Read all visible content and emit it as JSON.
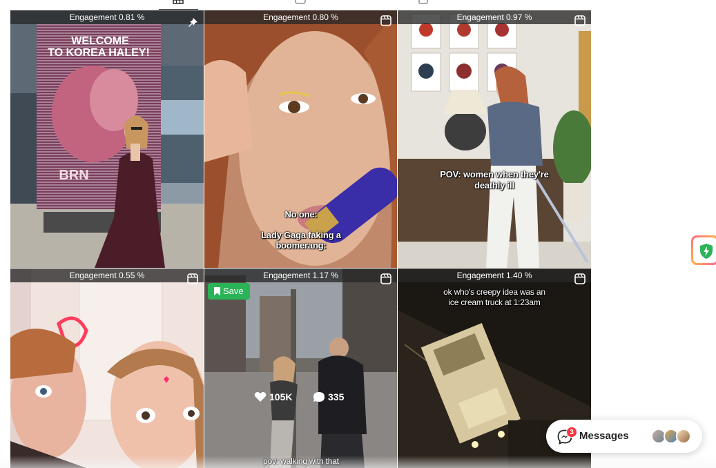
{
  "tabs": [
    {
      "icon": "grid-icon",
      "active": true
    },
    {
      "icon": "reels-icon",
      "active": false
    },
    {
      "icon": "tagged-icon",
      "active": false
    }
  ],
  "posts": [
    {
      "engagement": "Engagement 0.81 %",
      "type_icon": "pin-icon",
      "overlay": [
        "WELCOME",
        "TO KOREA HALEY!"
      ],
      "billboard_brand": "BRN"
    },
    {
      "engagement": "Engagement 0.80 %",
      "type_icon": "reel-icon",
      "overlay": [
        "No one:",
        "Lady Gaga faking a",
        "boomerang:"
      ]
    },
    {
      "engagement": "Engagement 0.97 %",
      "type_icon": "reel-icon",
      "overlay": [
        "POV: women when they're",
        "deathly ill"
      ]
    },
    {
      "engagement": "Engagement 0.55 %",
      "type_icon": "reel-icon",
      "overlay": []
    },
    {
      "engagement": "Engagement 1.17 %",
      "type_icon": "reel-icon",
      "save_label": "Save",
      "likes": "105K",
      "comments": "335",
      "overlay": [
        "pov: walking with that"
      ]
    },
    {
      "engagement": "Engagement 1.40 %",
      "type_icon": "reel-icon",
      "overlay": [
        "ok who's creepy idea was an",
        "ice cream truck at 1:23am"
      ]
    }
  ],
  "messages": {
    "label": "Messages",
    "unread": "3"
  },
  "colors": {
    "save_green": "#2bb357",
    "badge_red": "#ff3040",
    "engagement_bar": "#282828"
  }
}
